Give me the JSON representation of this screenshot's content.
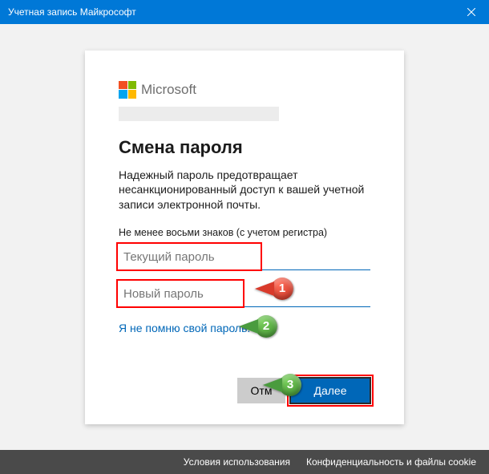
{
  "titlebar": {
    "title": "Учетная запись Майкрософт"
  },
  "logo": {
    "brand_text": "Microsoft"
  },
  "main": {
    "heading": "Смена пароля",
    "description": "Надежный пароль предотвращает несанкционированный доступ к вашей учетной записи электронной почты.",
    "hint": "Не менее восьми знаков (с учетом регистра)",
    "current_password_placeholder": "Текущий пароль",
    "new_password_placeholder": "Новый пароль",
    "forgot_link": "Я не помню свой пароль."
  },
  "buttons": {
    "cancel": "Отм",
    "next": "Далее"
  },
  "footer": {
    "terms": "Условия использования",
    "privacy": "Конфиденциальность и файлы cookie"
  },
  "callouts": {
    "c1": "1",
    "c2": "2",
    "c3": "3"
  }
}
